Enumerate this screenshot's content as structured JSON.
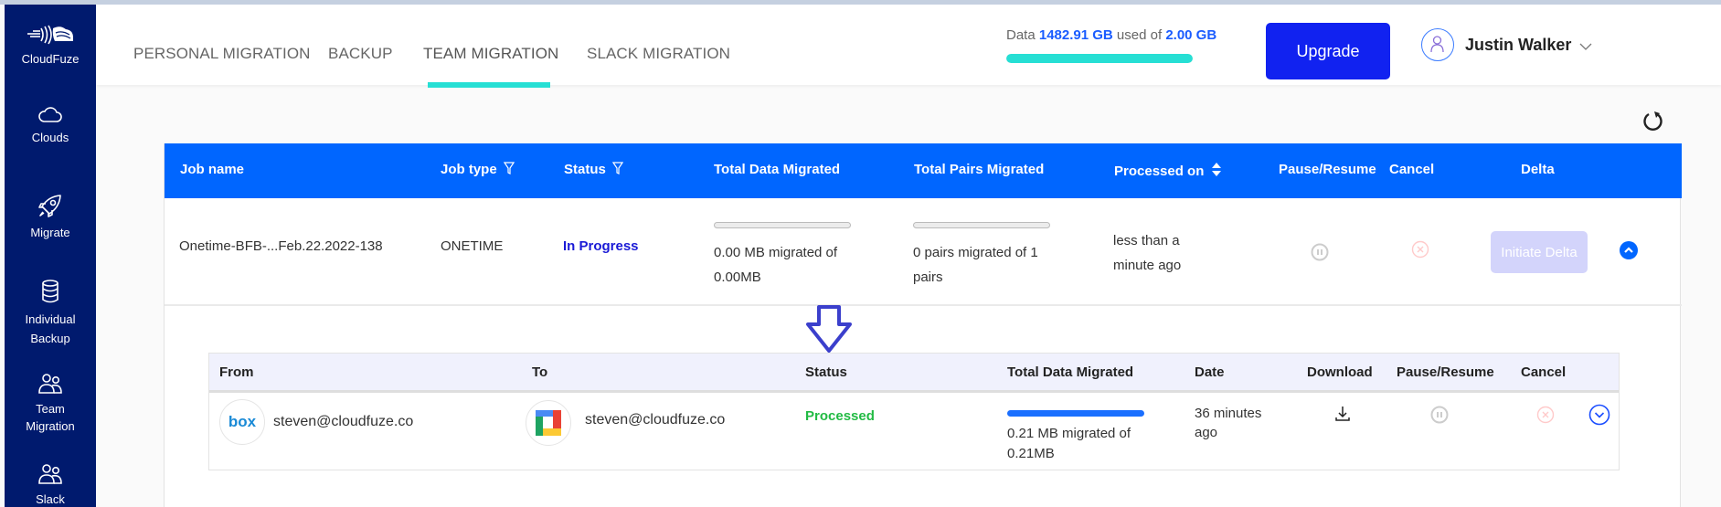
{
  "sidebar": {
    "items": [
      {
        "label": "CloudFuze",
        "icon": "cloudfuze-logo-icon"
      },
      {
        "label": "Clouds",
        "icon": "cloud-icon"
      },
      {
        "label": "Migrate",
        "icon": "rocket-icon"
      },
      {
        "label_line1": "Individual",
        "label_line2": "Backup",
        "icon": "database-icon"
      },
      {
        "label_line1": "Team",
        "label_line2": "Migration",
        "icon": "users-icon"
      },
      {
        "label": "Slack",
        "icon": "users-icon"
      }
    ]
  },
  "header": {
    "tabs": [
      {
        "label": "PERSONAL MIGRATION",
        "active": false
      },
      {
        "label": "BACKUP",
        "active": false
      },
      {
        "label": "TEAM MIGRATION",
        "active": true
      },
      {
        "label": "SLACK MIGRATION",
        "active": false
      }
    ],
    "usage": {
      "prefix": "Data",
      "used": "1482.91 GB",
      "middle": "used of",
      "total": "2.00 GB",
      "fill_percent": 100
    },
    "upgrade_label": "Upgrade",
    "user_name": "Justin Walker"
  },
  "colors": {
    "sidebar": "#001a6e",
    "accent": "#0066ff",
    "upgrade": "#1122f0",
    "teal": "#26dfd4",
    "in_progress": "#1a1ad6",
    "processed": "#22bb44"
  },
  "jobs_table": {
    "headers": [
      "Job name",
      "Job type",
      "Status",
      "Total Data Migrated",
      "Total Pairs Migrated",
      "Processed on",
      "Pause/Resume",
      "Cancel",
      "Delta"
    ],
    "rows": [
      {
        "job_name": "Onetime-BFB-...Feb.22.2022-138",
        "job_type": "ONETIME",
        "status": "In Progress",
        "data_line1": "0.00 MB migrated of",
        "data_line2": "0.00MB",
        "data_progress": 0,
        "pairs_line1": "0 pairs migrated of 1",
        "pairs_line2": "pairs",
        "pairs_progress": 0,
        "processed_line1": "less than a",
        "processed_line2": "minute ago",
        "delta_label": "Initiate Delta"
      }
    ]
  },
  "pairs_table": {
    "headers": [
      "From",
      "To",
      "Status",
      "Total Data Migrated",
      "Date",
      "Download",
      "Pause/Resume",
      "Cancel"
    ],
    "rows": [
      {
        "from_cloud": "box",
        "from_email": "steven@cloudfuze.co",
        "to_cloud": "google-workspace",
        "to_email": "steven@cloudfuze.co",
        "status": "Processed",
        "data_line1": "0.21 MB migrated of",
        "data_line2": "0.21MB",
        "data_progress": 100,
        "date_line1": "36 minutes",
        "date_line2": "ago"
      }
    ]
  }
}
